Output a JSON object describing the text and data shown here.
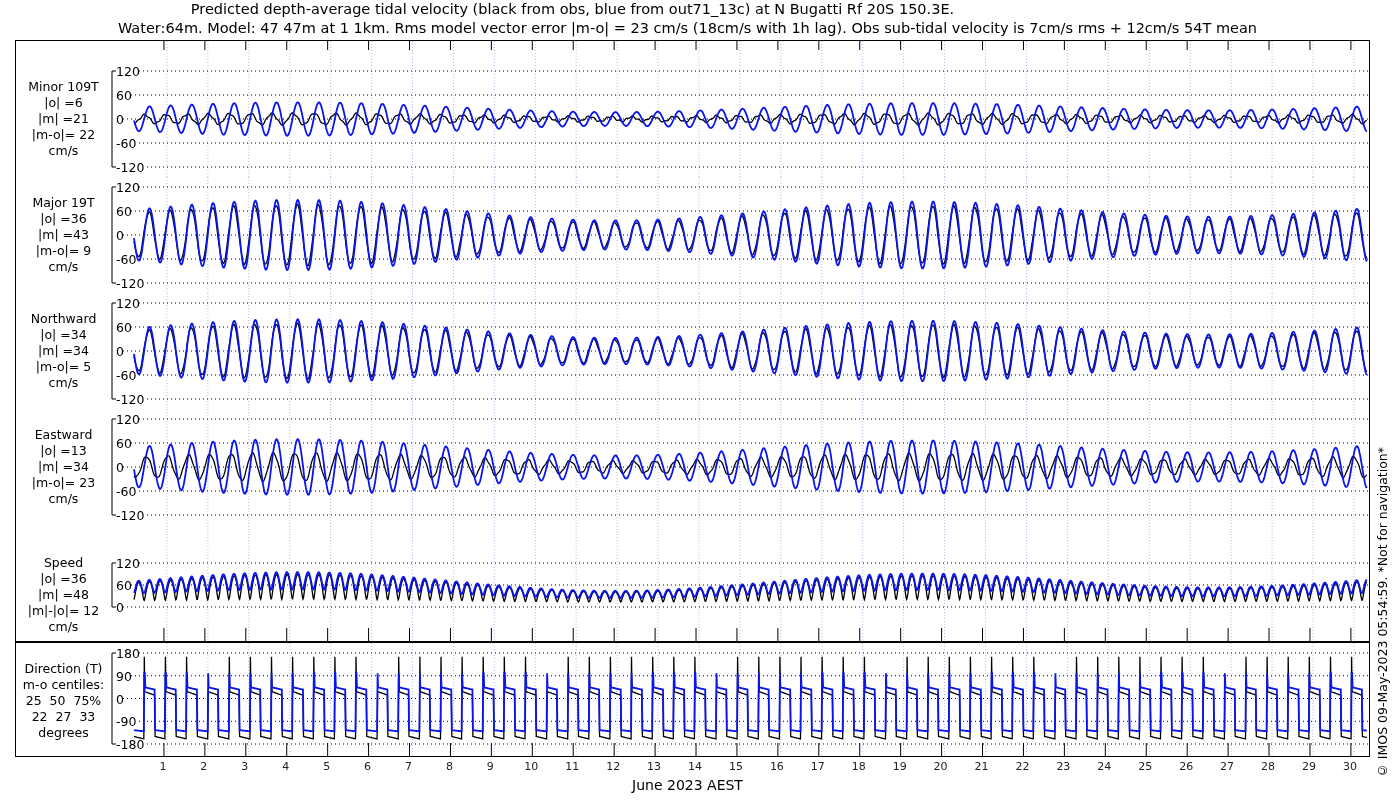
{
  "title_lines": [
    "Predicted depth-average tidal velocity (black from obs, blue from out71_13c) at N Bugatti Rf 20S 150.3E.",
    "Water:64m. Model: 47 47m at 1 1km. Rms model vector error |m-o| = 23 cm/s (18cm/s with 1h lag). Obs sub-tidal velocity is 7cm/s rms + 12cm/s 54T mean"
  ],
  "panels": [
    {
      "kind": "velocity",
      "label": [
        "Minor 109T",
        "|o| =6",
        "|m| =21",
        "|m-o|= 22",
        "cm/s"
      ],
      "yticks": [
        "120",
        "60",
        "0",
        "-60",
        "-120"
      ]
    },
    {
      "kind": "velocity",
      "label": [
        "Major 19T",
        "|o| =36",
        "|m| =43",
        "|m-o|= 9",
        "cm/s"
      ],
      "yticks": [
        "120",
        "60",
        "0",
        "-60",
        "-120"
      ]
    },
    {
      "kind": "velocity",
      "label": [
        "Northward",
        "|o| =34",
        "|m| =34",
        "|m-o|= 5",
        "cm/s"
      ],
      "yticks": [
        "120",
        "60",
        "0",
        "-60",
        "-120"
      ]
    },
    {
      "kind": "velocity",
      "label": [
        "Eastward",
        "|o| =13",
        "|m| =34",
        "|m-o|= 23",
        "cm/s"
      ],
      "yticks": [
        "120",
        "60",
        "0",
        "-60",
        "-120"
      ]
    },
    {
      "kind": "speed",
      "label": [
        "Speed",
        "|o| =36",
        "|m| =48",
        "|m|-|o|= 12",
        "cm/s"
      ],
      "yticks": [
        "120",
        "60",
        "0"
      ]
    },
    {
      "kind": "direction",
      "label": [
        "Direction (T)",
        "m-o centiles:",
        "25  50  75%",
        "22  27  33",
        "degrees"
      ],
      "yticks": [
        "180",
        "90",
        "0",
        "-90",
        "-180"
      ]
    }
  ],
  "day_labels": [
    "1",
    "2",
    "3",
    "4",
    "5",
    "6",
    "7",
    "8",
    "9",
    "10",
    "11",
    "12",
    "13",
    "14",
    "15",
    "16",
    "17",
    "18",
    "19",
    "20",
    "21",
    "22",
    "23",
    "24",
    "25",
    "26",
    "27",
    "28",
    "29",
    "30"
  ],
  "xlabel": "June 2023 AEST",
  "footnote": "© IMOS 09-May-2023 05:54:59.  *Not for navigation*"
}
